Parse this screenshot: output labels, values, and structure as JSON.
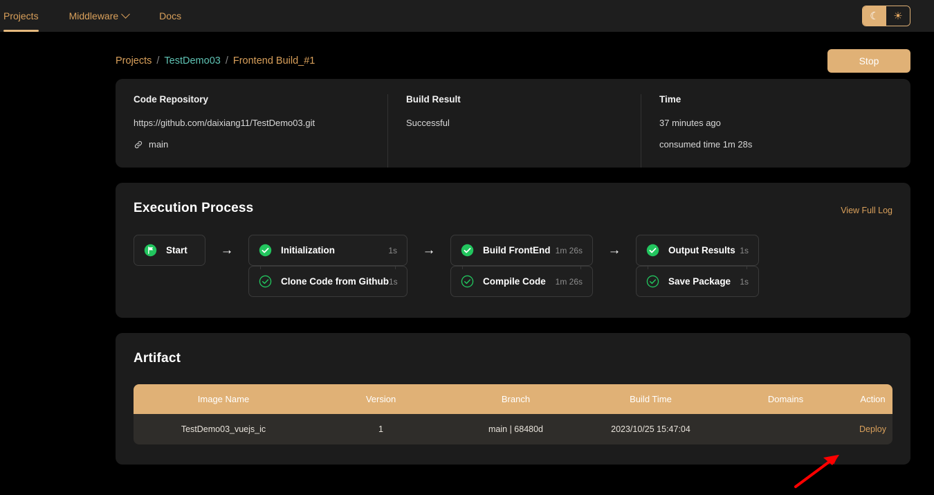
{
  "nav": {
    "items": [
      {
        "label": "Projects",
        "icon": "",
        "active": true
      },
      {
        "label": "Middleware",
        "icon": "chevron-down-icon",
        "active": false
      },
      {
        "label": "Docs",
        "icon": "",
        "active": false
      }
    ],
    "theme_toggle": {
      "dark_icon": "moon-icon",
      "light_icon": "sun-icon",
      "active": "dark"
    }
  },
  "breadcrumb": {
    "root": "Projects",
    "project": "TestDemo03",
    "current": "Frontend Build_#1",
    "separator": "/"
  },
  "actions": {
    "stop_label": "Stop"
  },
  "summary": {
    "repo": {
      "title": "Code Repository",
      "url": "https://github.com/daixiang11/TestDemo03.git",
      "branch": "main",
      "branch_icon": "link-icon"
    },
    "result": {
      "title": "Build Result",
      "value": "Successful"
    },
    "time": {
      "title": "Time",
      "relative": "37 minutes ago",
      "consumed": "consumed time 1m 28s"
    }
  },
  "execution": {
    "title": "Execution Process",
    "view_log": "View Full Log",
    "arrow": "→",
    "stages": [
      {
        "nodes": [
          {
            "label": "Start",
            "duration": "",
            "icon": "flag-filled-icon"
          }
        ]
      },
      {
        "nodes": [
          {
            "label": "Initialization",
            "duration": "1s",
            "icon": "check-filled-icon"
          },
          {
            "label": "Clone Code from Github",
            "duration": "1s",
            "icon": "check-outline-icon"
          }
        ]
      },
      {
        "nodes": [
          {
            "label": "Build FrontEnd",
            "duration": "1m 26s",
            "icon": "check-filled-icon"
          },
          {
            "label": "Compile Code",
            "duration": "1m 26s",
            "icon": "check-outline-icon"
          }
        ]
      },
      {
        "nodes": [
          {
            "label": "Output Results",
            "duration": "1s",
            "icon": "check-filled-icon"
          },
          {
            "label": "Save Package",
            "duration": "1s",
            "icon": "check-outline-icon"
          }
        ]
      }
    ]
  },
  "artifact": {
    "title": "Artifact",
    "columns": [
      "Image Name",
      "Version",
      "Branch",
      "Build Time",
      "Domains",
      "Action"
    ],
    "rows": [
      {
        "image_name": "TestDemo03_vuejs_ic",
        "version": "1",
        "branch": "main | 68480d",
        "build_time": "2023/10/25 15:47:04",
        "domains": "",
        "action": "Deploy"
      }
    ]
  },
  "colors": {
    "accent": "#e0b176",
    "page_bg": "#000000",
    "card_bg": "#1c1c1c",
    "success": "#22c55e",
    "annotation": "#fe0000",
    "project_link": "#5fc3b4"
  }
}
